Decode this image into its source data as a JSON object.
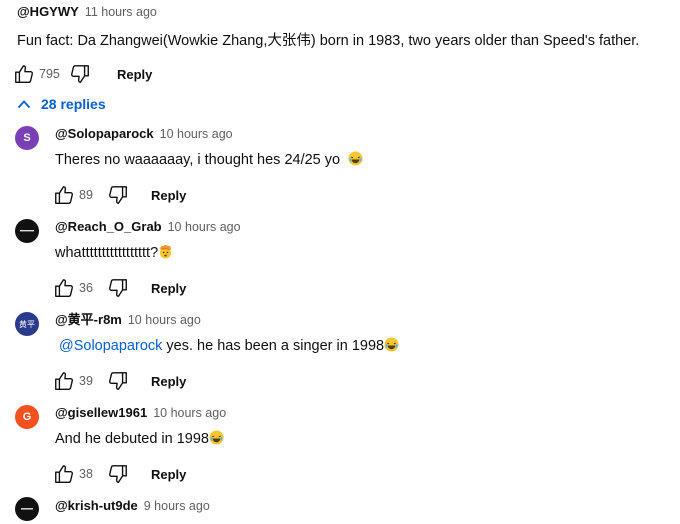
{
  "top_comment": {
    "author": "@HGYWY",
    "time": "11 hours ago",
    "text": "Fun fact: Da Zhangwei(Wowkie Zhang,大张伟) born in 1983, two years older than Speed's father.",
    "likes": "795",
    "reply_label": "Reply"
  },
  "replies_toggle": {
    "label": "28 replies"
  },
  "replies": [
    {
      "avatar_letter": "S",
      "avatar_color": "#7b3fb4",
      "author": "@Solopaparock",
      "time": "10 hours ago",
      "text": "Theres no waaaaaay, i thought hes 24/25 yo",
      "emoji": "laughing-emoji",
      "likes": "89",
      "reply_label": "Reply"
    },
    {
      "avatar_letter": "",
      "avatar_color": "#111111",
      "author": "@Reach_O_Grab",
      "time": "10 hours ago",
      "text": "whattttttttttttttttt?",
      "emoji": "exploding-head-emoji",
      "likes": "36",
      "reply_label": "Reply"
    },
    {
      "avatar_letter": "黄平",
      "avatar_color": "#2a3a8c",
      "author": "@黄平-r8m",
      "time": "10 hours ago",
      "mention": "@Solopaparock",
      "text": "yes. he has been a singer in 1998",
      "emoji": "laughing-emoji",
      "likes": "39",
      "reply_label": "Reply"
    },
    {
      "avatar_letter": "G",
      "avatar_color": "#f4511e",
      "author": "@gisellew1961",
      "time": "10 hours ago",
      "text": "And he debuted in 1998",
      "emoji": "laughing-emoji",
      "likes": "38",
      "reply_label": "Reply"
    },
    {
      "avatar_letter": "",
      "avatar_color": "#111111",
      "author": "@krish-ut9de",
      "time": "9 hours ago"
    }
  ],
  "colors": {
    "link_blue": "#065fd4",
    "meta_gray": "#606060"
  },
  "icons": [
    "thumbs-up-icon",
    "thumbs-down-icon",
    "chevron-up-icon"
  ]
}
